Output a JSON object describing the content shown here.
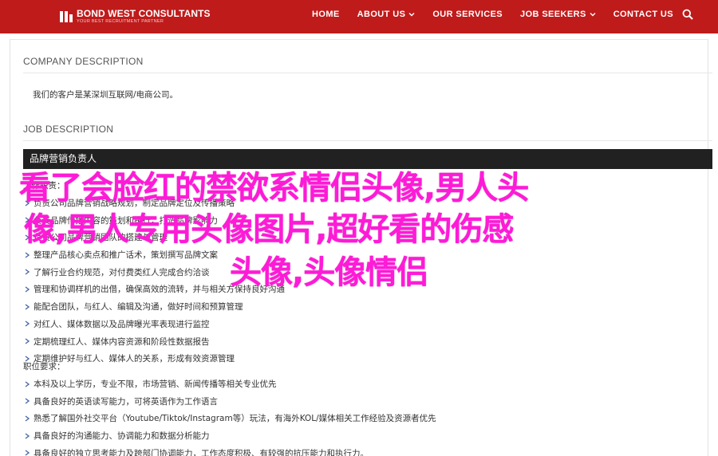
{
  "brand": {
    "name": "BOND WEST CONSULTANTS",
    "tagline": "YOUR BEST RECRUITMENT PARTNER"
  },
  "nav": {
    "items": [
      {
        "label": "HOME",
        "dropdown": false
      },
      {
        "label": "ABOUT US",
        "dropdown": true
      },
      {
        "label": "OUR SERVICES",
        "dropdown": false
      },
      {
        "label": "JOB SEEKERS",
        "dropdown": true
      },
      {
        "label": "CONTACT US",
        "dropdown": false
      }
    ],
    "search_icon": "search-icon"
  },
  "company": {
    "heading": "COMPANY DESCRIPTION",
    "text": "我们的客户是某深圳互联网/电商公司。"
  },
  "job": {
    "heading": "JOB DESCRIPTION",
    "title": "品牌营销负责人",
    "duties_label": "工作职责：",
    "duties": [
      "负责公司品牌营销战略规划，制定品牌定位及传播策略",
      "负责品牌传播内容的策划和执行，打造品牌影响力",
      "负责公司品牌营销团队的搭建与管理",
      "整理产品核心卖点和推广话术，策划撰写品牌文案",
      "了解行业合约规范，对付费类红人完成合约洽谈",
      "管理和协调样机的出借，确保高效的流转，并与相关方保持良好沟通",
      "能配合团队，与红人、编辑及沟通，做好时间和预算管理",
      "对红人、媒体数据以及品牌曝光率表现进行监控",
      "定期梳理红人、媒体内容资源和阶段性数据报告",
      "定期维护好与红人、媒体人的关系，形成有效资源管理"
    ],
    "requirements_label": "职位要求：",
    "requirements": [
      "本科及以上学历，专业不限，市场营销、新闻传播等相关专业优先",
      "具备良好的英语读写能力，可将英语作为工作语言",
      "熟悉了解国外社交平台（Youtube/Tiktok/Instagram等）玩法，有海外KOL/媒体相关工作经验及资源者优先",
      "具备良好的沟通能力、协调能力和数据分析能力",
      "具备良好的独立思考能力及跨部门协调能力，工作态度积极、有较强的抗压能力和执行力。"
    ]
  },
  "overlay": {
    "line1": "看了会脸红的禁欲系情侣头像,男人头",
    "line2": "像,男人专用头像图片,超好看的伤感",
    "line3": "头像,头像情侣"
  },
  "colors": {
    "header_bg": "#bf1b1b",
    "job_bar_bg": "#212121",
    "bullet": "#4a6aa8",
    "overlay_text": "#ff1ad8"
  }
}
